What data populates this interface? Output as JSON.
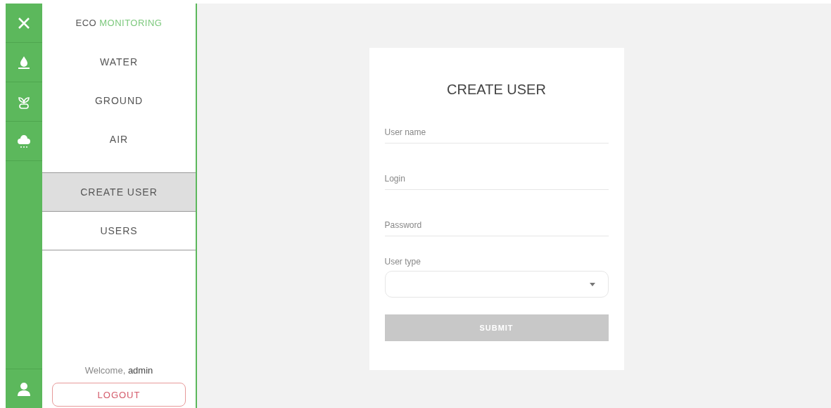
{
  "sidebar": {
    "brand": {
      "first": "ECO",
      "second": "MONITORING"
    },
    "sections": [
      {
        "label": "WATER",
        "selected": false
      },
      {
        "label": "GROUND",
        "selected": false
      },
      {
        "label": "AIR",
        "selected": false
      }
    ],
    "admin_items": [
      {
        "label": "CREATE USER",
        "selected": true
      },
      {
        "label": "USERS",
        "selected": false
      }
    ],
    "welcome": {
      "text": "Welcome,",
      "user": "admin"
    },
    "logout": "LOGOUT"
  },
  "form": {
    "title": "CREATE USER",
    "fields": [
      {
        "placeholder": "User name"
      },
      {
        "placeholder": "Login"
      },
      {
        "placeholder": "Password"
      }
    ],
    "select": {
      "label": "User type"
    },
    "submit": {
      "label": "SUBMIT",
      "disabled": true
    }
  }
}
